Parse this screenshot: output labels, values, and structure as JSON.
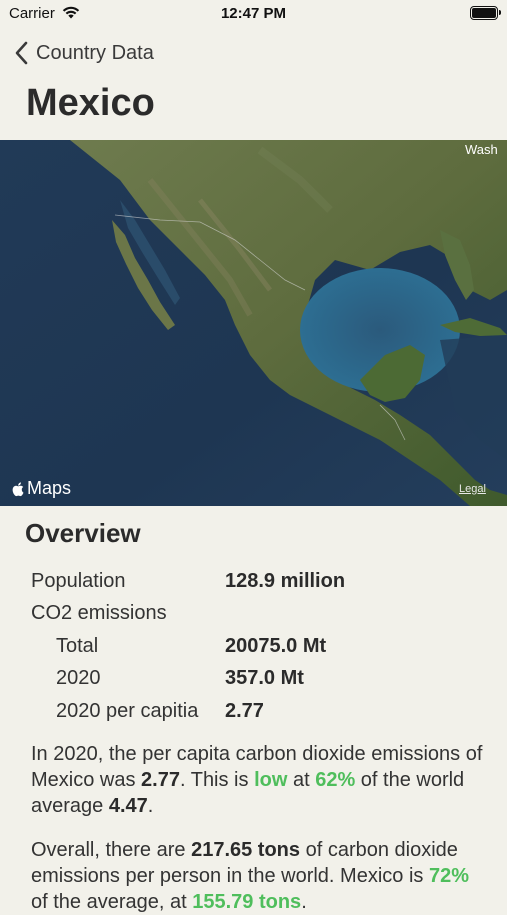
{
  "status_bar": {
    "carrier": "Carrier",
    "time": "12:47 PM"
  },
  "nav": {
    "back_label": "Country Data",
    "title": "Mexico"
  },
  "map": {
    "attribution": "Maps",
    "legal": "Legal",
    "edge_label": "Wash"
  },
  "overview": {
    "heading": "Overview",
    "stats": [
      {
        "label": "Population",
        "value": "128.9 million"
      },
      {
        "label": "CO2 emissions",
        "value": ""
      },
      {
        "label": "Total",
        "value": "20075.0 Mt"
      },
      {
        "label": "2020",
        "value": "357.0 Mt"
      },
      {
        "label": "2020 per capitia",
        "value": "2.77"
      }
    ],
    "para1": {
      "t1": "In 2020, the per capita carbon dioxide emissions of Mexico was ",
      "b1": "2.77",
      "t2": ". This is ",
      "g1": "low",
      "t3": " at ",
      "g2": "62%",
      "t4": " of the world average ",
      "b2": "4.47",
      "t5": "."
    },
    "para2": {
      "t1": "Overall, there are ",
      "b1": "217.65 tons",
      "t2": " of carbon dioxide emissions per person in the world. Mexico is ",
      "g1": "72%",
      "t3": " of the average, at ",
      "g2": "155.79 tons",
      "t4": "."
    }
  },
  "colors": {
    "background": "#f2f1ea",
    "accent_green": "#4fbe5c",
    "text": "#333333"
  }
}
